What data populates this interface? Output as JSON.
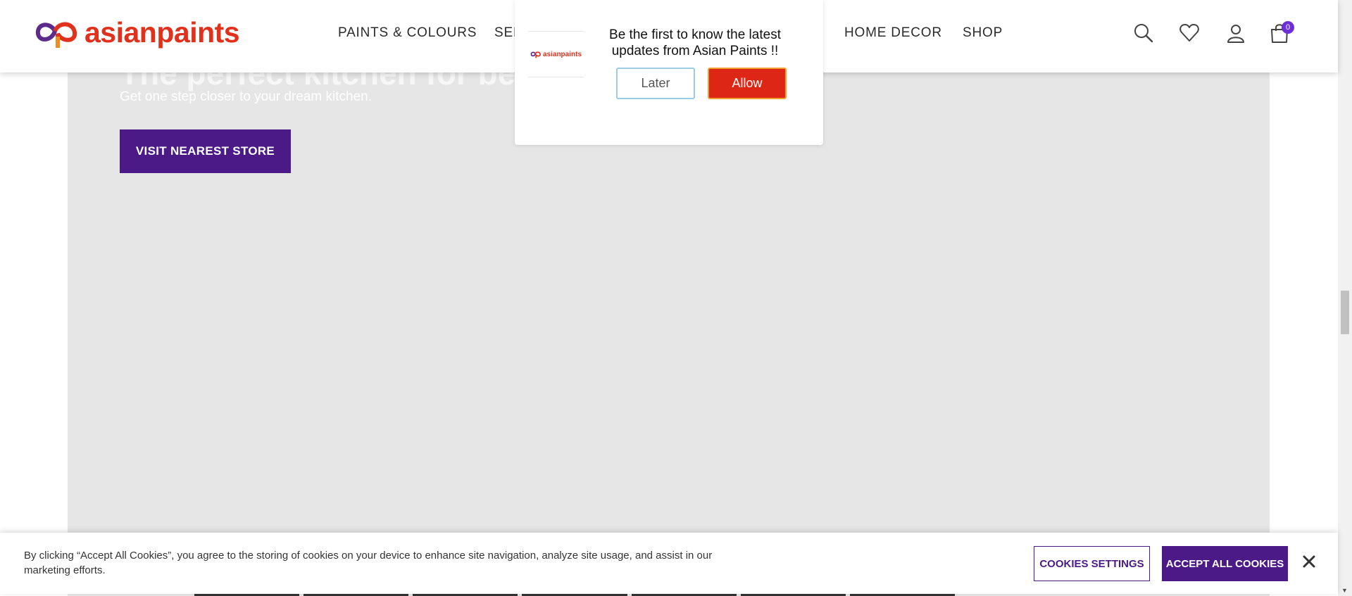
{
  "header": {
    "brand": "asianpaints",
    "nav": [
      "PAINTS & COLOURS",
      "SER",
      "HOME DECOR",
      "SHOP"
    ],
    "cart_count": "0",
    "icons": [
      "search-icon",
      "heart-icon",
      "user-icon",
      "cart-icon"
    ]
  },
  "hero": {
    "title": "The perfect kitchen for better",
    "subtitle": "Get one step closer to your dream kitchen.",
    "cta_label": "VISIT NEAREST STORE"
  },
  "notification": {
    "logo_text": "asianpaints",
    "message": "Be the first to know the latest updates from Asian Paints !!",
    "later_label": "Later",
    "allow_label": "Allow"
  },
  "cookie": {
    "text": "By clicking “Accept All Cookies”, you agree to the storing of cookies on your device to enhance site navigation, analyze site usage, and assist in our marketing efforts.",
    "settings_label": "COOKIES SETTINGS",
    "accept_label": "ACCEPT ALL COOKIES"
  },
  "colors": {
    "brand_red": "#e1311c",
    "brand_purple": "#4b1a87",
    "hero_bg": "#e6e6e6",
    "badge": "#6d2fd6"
  }
}
